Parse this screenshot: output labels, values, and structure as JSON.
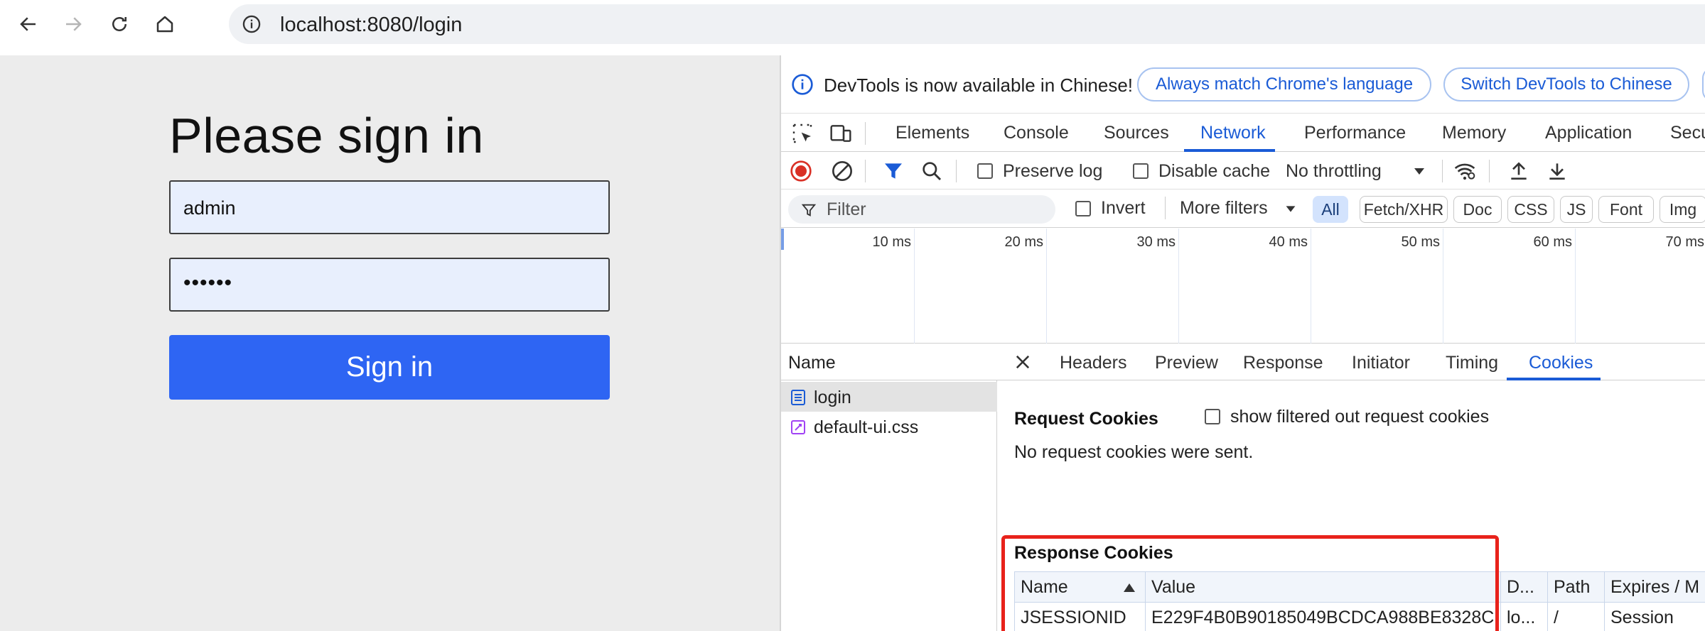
{
  "browser": {
    "url": "localhost:8080/login"
  },
  "page": {
    "title": "Please sign in",
    "username_value": "admin",
    "password_value": "••••••",
    "signin_label": "Sign in"
  },
  "devtools": {
    "infobar": {
      "message": "DevTools is now available in Chinese!",
      "btn_match": "Always match Chrome's language",
      "btn_switch": "Switch DevTools to Chinese"
    },
    "tabs": [
      "Elements",
      "Console",
      "Sources",
      "Network",
      "Performance",
      "Memory",
      "Application",
      "Secu"
    ],
    "active_tab": "Network",
    "toolbar": {
      "preserve_log": "Preserve log",
      "disable_cache": "Disable cache",
      "throttling": "No throttling"
    },
    "filterbar": {
      "filter_placeholder": "Filter",
      "invert": "Invert",
      "more_filters": "More filters",
      "chips": [
        "All",
        "Fetch/XHR",
        "Doc",
        "CSS",
        "JS",
        "Font",
        "Img"
      ],
      "active_chip": "All"
    },
    "timeline": {
      "ticks": [
        "10 ms",
        "20 ms",
        "30 ms",
        "40 ms",
        "50 ms",
        "60 ms",
        "70 ms"
      ]
    },
    "requests": {
      "header": "Name",
      "items": [
        {
          "name": "login",
          "icon": "document-icon",
          "selected": true
        },
        {
          "name": "default-ui.css",
          "icon": "stylesheet-icon",
          "selected": false
        }
      ]
    },
    "detail": {
      "tabs": [
        "Headers",
        "Preview",
        "Response",
        "Initiator",
        "Timing",
        "Cookies"
      ],
      "active_tab": "Cookies",
      "request_cookies_title": "Request Cookies",
      "show_filtered_label": "show filtered out request cookies",
      "no_request_cookies": "No request cookies were sent.",
      "response_cookies_title": "Response Cookies",
      "table": {
        "headers": [
          "Name",
          "Value",
          "D...",
          "Path",
          "Expires / M"
        ],
        "rows": [
          [
            "JSESSIONID",
            "E229F4B0B90185049BCDCA988BE8328C",
            "lo...",
            "/",
            "Session"
          ]
        ]
      }
    }
  },
  "colors": {
    "accent": "#1a5bd6",
    "signin_button": "#2e65f3",
    "highlight": "#e8221b"
  }
}
